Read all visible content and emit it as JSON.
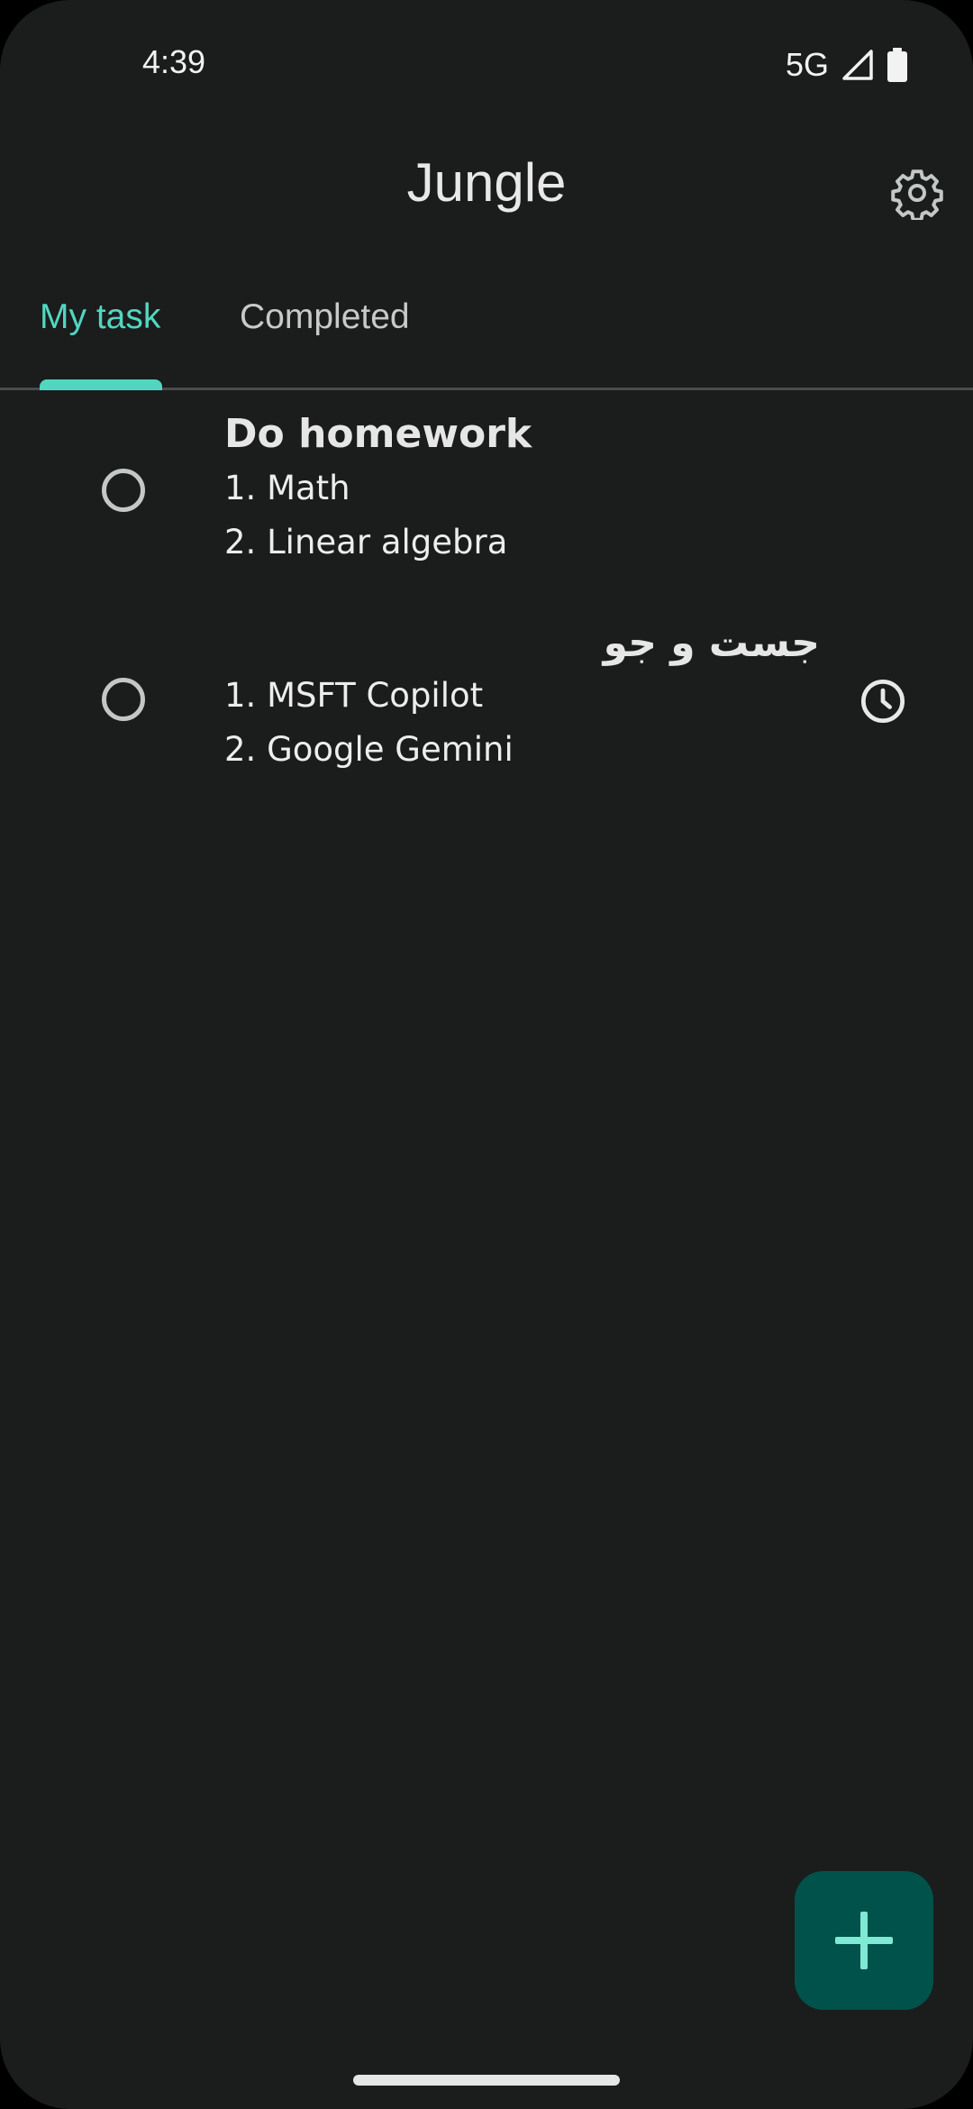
{
  "status_bar": {
    "time": "4:39",
    "network": "5G",
    "icons": [
      "signal-icon",
      "battery-icon"
    ]
  },
  "app_bar": {
    "title": "Jungle",
    "settings_icon": "gear-icon"
  },
  "tabs": [
    {
      "label": "My task",
      "selected": true
    },
    {
      "label": "Completed",
      "selected": false
    }
  ],
  "tasks": [
    {
      "title": "Do homework",
      "lines": [
        "1. Math",
        "2. Linear algebra"
      ]
    },
    {
      "title": "جست و جو",
      "lines": [
        "1. MSFT Copilot",
        "2. Google Gemini"
      ],
      "reminder_icon": "clock-icon"
    }
  ],
  "fab": {
    "icon": "plus-icon"
  },
  "colors": {
    "background": "#1b1c1c",
    "accent": "#52d6c0",
    "fab_background": "#00524a",
    "fab_icon": "#7fe9d4"
  }
}
